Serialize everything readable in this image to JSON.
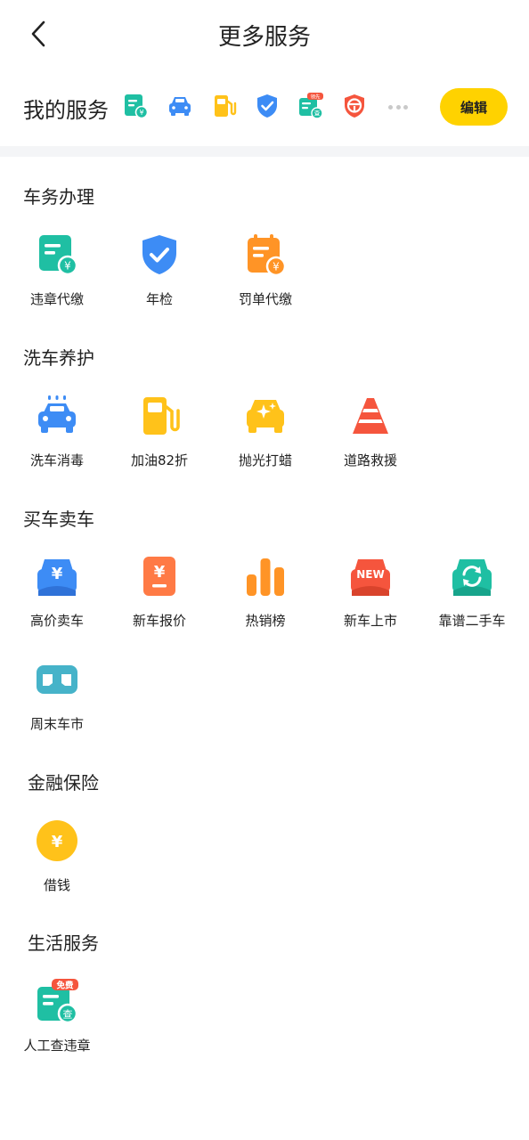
{
  "header": {
    "title": "更多服务",
    "back_icon": "back-arrow-icon"
  },
  "my_services": {
    "label": "我的服务",
    "edit_label": "编辑",
    "icons": [
      "violation-pay-icon",
      "car-wash-icon",
      "fuel-icon",
      "inspection-shield-icon",
      "free-violation-check-icon",
      "steering-wheel-icon"
    ],
    "free_badge": "领先",
    "check_text": "查"
  },
  "sections": [
    {
      "title": "车务办理",
      "items": [
        {
          "label": "违章代缴",
          "icon": "violation-pay-icon"
        },
        {
          "label": "年检",
          "icon": "inspection-shield-icon"
        },
        {
          "label": "罚单代缴",
          "icon": "ticket-pay-icon"
        }
      ]
    },
    {
      "title": "洗车养护",
      "items": [
        {
          "label": "洗车消毒",
          "icon": "car-wash-icon"
        },
        {
          "label": "加油82折",
          "icon": "fuel-icon"
        },
        {
          "label": "抛光打蜡",
          "icon": "polish-icon"
        },
        {
          "label": "道路救援",
          "icon": "road-cone-icon"
        }
      ]
    },
    {
      "title": "买车卖车",
      "items": [
        {
          "label": "高价卖车",
          "icon": "sell-car-icon"
        },
        {
          "label": "新车报价",
          "icon": "price-quote-icon"
        },
        {
          "label": "热销榜",
          "icon": "bar-chart-icon"
        },
        {
          "label": "新车上市",
          "icon": "new-car-icon",
          "badge": "NEW"
        },
        {
          "label": "靠谱二手车",
          "icon": "used-car-icon"
        },
        {
          "label": "周末车市",
          "icon": "vr-glasses-icon"
        }
      ]
    },
    {
      "title": "金融保险",
      "items": [
        {
          "label": "借钱",
          "icon": "coin-icon"
        }
      ]
    },
    {
      "title": "生活服务",
      "items": [
        {
          "label": "人工查违章",
          "icon": "manual-check-icon",
          "badge": "免费",
          "badge_text2": "查"
        }
      ]
    }
  ],
  "currency_symbol": "¥",
  "colors": {
    "accent": "#ffd200",
    "teal": "#1fbfa3",
    "blue": "#3d8cf5",
    "orange": "#ff9426",
    "yellow": "#ffc21a",
    "red": "#f5553d"
  }
}
